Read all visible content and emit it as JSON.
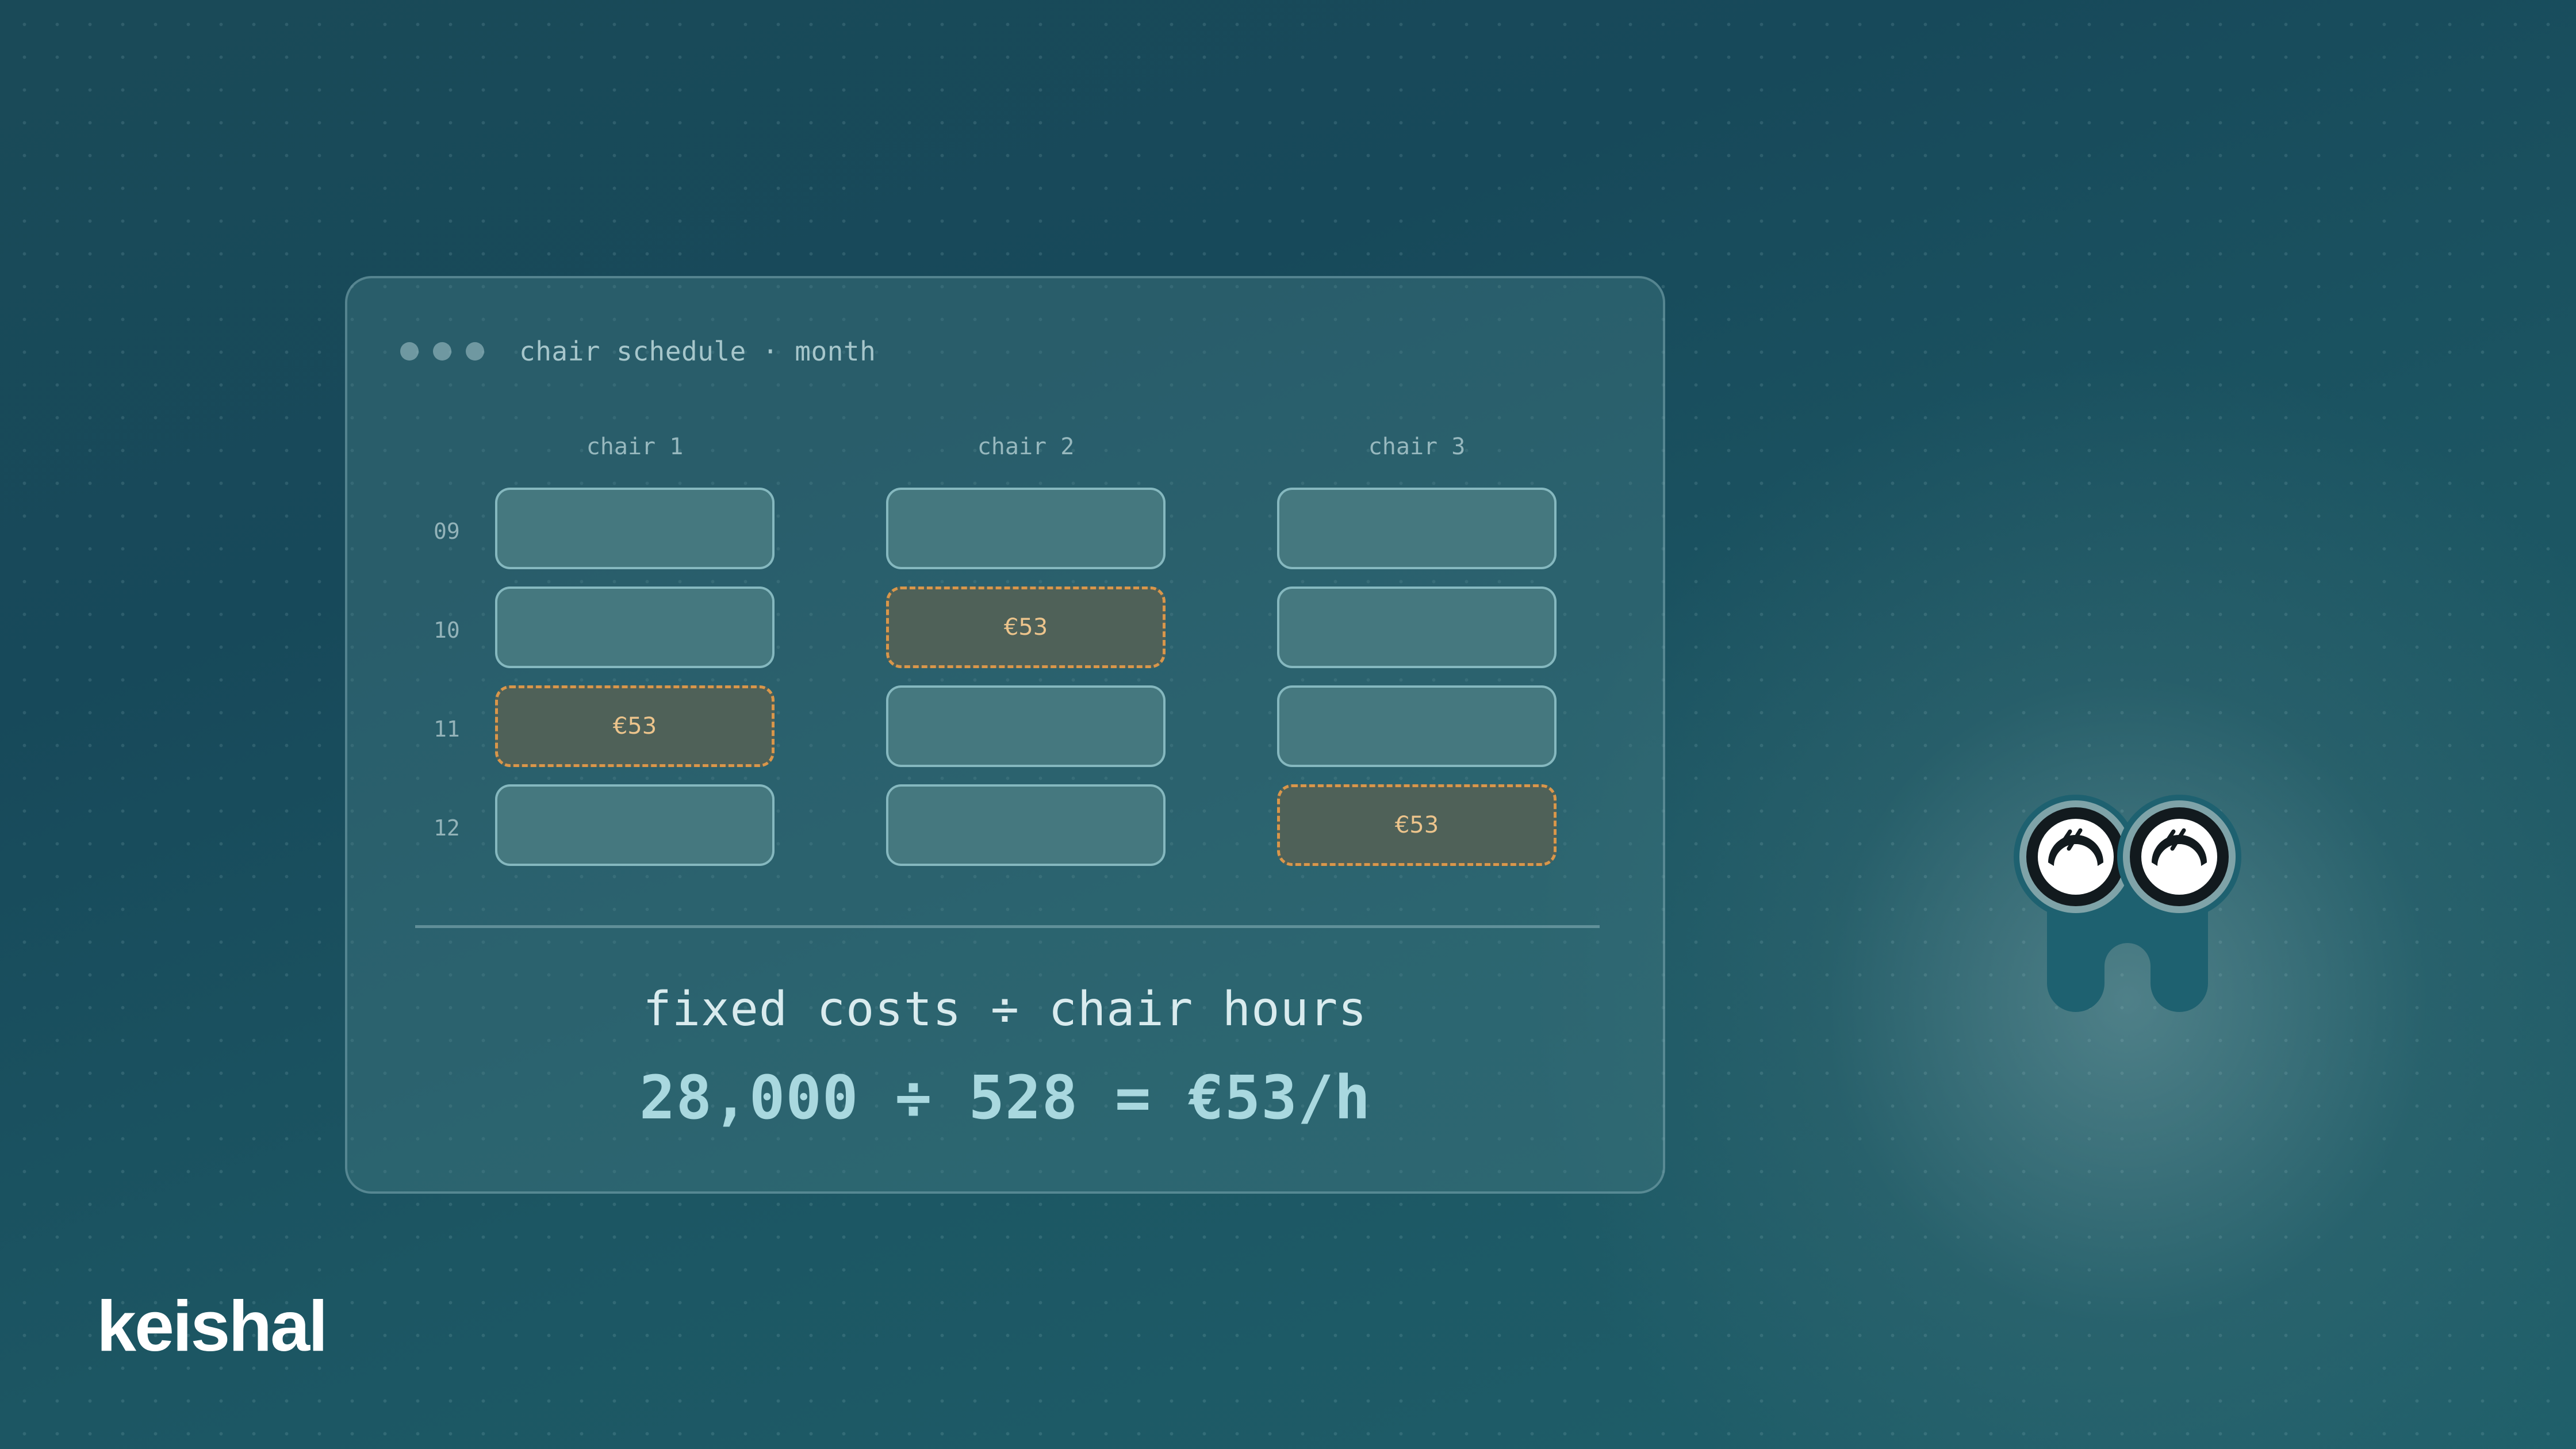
{
  "window": {
    "title": "chair schedule · month"
  },
  "schedule": {
    "columns": [
      "chair 1",
      "chair 2",
      "chair 3"
    ],
    "rows": [
      "09",
      "10",
      "11",
      "12"
    ],
    "bookings": [
      {
        "chair": "chair 2",
        "hour": "10",
        "price": "€53"
      },
      {
        "chair": "chair 1",
        "hour": "11",
        "price": "€53"
      },
      {
        "chair": "chair 3",
        "hour": "12",
        "price": "€53"
      }
    ]
  },
  "formula": {
    "text": "fixed costs ÷ chair hours",
    "result": "28,000 ÷ 528 = €53/h"
  },
  "brand": {
    "name": "keishal"
  },
  "icons": [
    "window-dot-icon",
    "mascot-icon"
  ],
  "colors": {
    "accent_booked": "#d9964a",
    "price_text": "#ecc48c",
    "slot_fill": "#45787f"
  }
}
